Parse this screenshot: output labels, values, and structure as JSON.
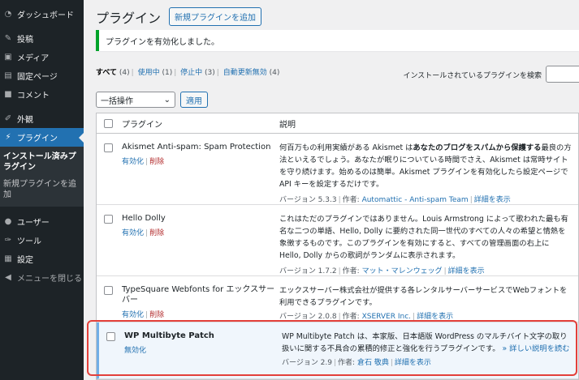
{
  "sidebar": {
    "items": [
      {
        "label": "ダッシュボード",
        "icon": "dashboard-icon"
      },
      {
        "label": "投稿",
        "icon": "pin-icon"
      },
      {
        "label": "メディア",
        "icon": "media-icon"
      },
      {
        "label": "固定ページ",
        "icon": "page-icon"
      },
      {
        "label": "コメント",
        "icon": "comment-icon"
      },
      {
        "label": "外観",
        "icon": "brush-icon"
      },
      {
        "label": "プラグイン",
        "icon": "plugin-icon"
      }
    ],
    "submenu": [
      "インストール済みプラグイン",
      "新規プラグインを追加"
    ],
    "items2": [
      {
        "label": "ユーザー",
        "icon": "user-icon"
      },
      {
        "label": "ツール",
        "icon": "wrench-icon"
      },
      {
        "label": "設定",
        "icon": "settings-icon"
      }
    ],
    "collapse": "メニューを閉じる"
  },
  "header": {
    "title": "プラグイン",
    "add_new": "新規プラグインを追加"
  },
  "notice": "プラグインを有効化しました。",
  "filters": [
    {
      "label": "すべて",
      "count": "(4)"
    },
    {
      "label": "使用中",
      "count": "(1)"
    },
    {
      "label": "停止中",
      "count": "(3)"
    },
    {
      "label": "自動更新無効",
      "count": "(4)"
    }
  ],
  "search": {
    "label": "インストールされているプラグインを検索"
  },
  "bulk": {
    "select": "一括操作",
    "apply": "適用"
  },
  "table": {
    "col_plugin": "プラグイン",
    "col_desc": "説明"
  },
  "plugins": [
    {
      "name": "Akismet Anti-spam: Spam Protection",
      "action1": "有効化",
      "action2": "削除",
      "desc_pre": "何百万もの利用実績がある Akismet は",
      "desc_bold": "あなたのブログをスパムから保護する",
      "desc_post": "最良の方法といえるでしょう。あなたが眠りについている時間でさえ、Akismet は常時サイトを守り続けます。始めるのは簡単。Akismet プラグインを有効化したら設定ページで API キーを設定するだけです。",
      "version": "バージョン 5.3.3",
      "author_label": "作者:",
      "author": "Automattic - Anti-spam Team",
      "details": "詳細を表示"
    },
    {
      "name": "Hello Dolly",
      "action1": "有効化",
      "action2": "削除",
      "desc": "これはただのプラグインではありません。Louis Armstrong によって歌われた最も有名な二つの単語、Hello, Dolly に要約された同一世代のすべての人々の希望と情熱を象徴するものです。このプラグインを有効にすると、すべての管理画面の右上に Hello, Dolly からの歌詞がランダムに表示されます。",
      "version": "バージョン 1.7.2",
      "author_label": "作者:",
      "author": "マット・マレンウェッグ",
      "details": "詳細を表示"
    },
    {
      "name": "TypeSquare Webfonts for エックスサーバー",
      "action1": "有効化",
      "action2": "削除",
      "desc": "エックスサーバー株式会社が提供する各レンタルサーバーサービスでWebフォントを利用できるプラグインです。",
      "version": "バージョン 2.0.8",
      "author_label": "作者:",
      "author": "XSERVER Inc.",
      "details": "詳細を表示"
    },
    {
      "name": "WP Multibyte Patch",
      "action1": "無効化",
      "desc": "WP Multibyte Patch は、本家版、日本語版 WordPress のマルチバイト文字の取り扱いに関する不具合の累積的修正と強化を行うプラグインです。",
      "more": "» 詳しい説明を読む",
      "version": "バージョン 2.9",
      "author_label": "作者:",
      "author": "倉石 敬典",
      "details": "詳細を表示"
    }
  ]
}
